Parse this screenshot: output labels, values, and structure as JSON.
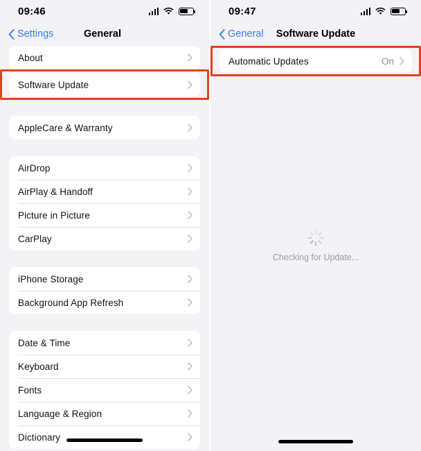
{
  "left": {
    "status": {
      "time": "09:46",
      "cellular_icon": "cellular-bars-icon",
      "wifi_icon": "wifi-icon",
      "battery_icon": "battery-icon"
    },
    "nav": {
      "back_label": "Settings",
      "title": "General",
      "back_icon": "chevron-left-icon"
    },
    "groups": [
      {
        "rows": [
          {
            "label": "About",
            "highlighted": false
          },
          {
            "label": "Software Update",
            "highlighted": true
          }
        ]
      },
      {
        "rows": [
          {
            "label": "AppleCare & Warranty",
            "highlighted": false
          }
        ]
      },
      {
        "rows": [
          {
            "label": "AirDrop",
            "highlighted": false
          },
          {
            "label": "AirPlay & Handoff",
            "highlighted": false
          },
          {
            "label": "Picture in Picture",
            "highlighted": false
          },
          {
            "label": "CarPlay",
            "highlighted": false
          }
        ]
      },
      {
        "rows": [
          {
            "label": "iPhone Storage",
            "highlighted": false
          },
          {
            "label": "Background App Refresh",
            "highlighted": false
          }
        ]
      },
      {
        "rows": [
          {
            "label": "Date & Time",
            "highlighted": false
          },
          {
            "label": "Keyboard",
            "highlighted": false
          },
          {
            "label": "Fonts",
            "highlighted": false
          },
          {
            "label": "Language & Region",
            "highlighted": false
          },
          {
            "label": "Dictionary",
            "highlighted": false
          }
        ]
      }
    ]
  },
  "right": {
    "status": {
      "time": "09:47",
      "cellular_icon": "cellular-bars-icon",
      "wifi_icon": "wifi-icon",
      "battery_icon": "battery-icon"
    },
    "nav": {
      "back_label": "General",
      "title": "Software Update",
      "back_icon": "chevron-left-icon"
    },
    "rows": [
      {
        "label": "Automatic Updates",
        "value": "On",
        "highlighted": true
      }
    ],
    "status_area": {
      "text": "Checking for Update...",
      "spinner_icon": "activity-spinner-icon"
    }
  },
  "colors": {
    "accent_blue": "#3c7ced",
    "highlight_red": "#e0421e",
    "background": "#f2f2f7",
    "card": "#ffffff",
    "secondary_text": "#8b8b90"
  }
}
